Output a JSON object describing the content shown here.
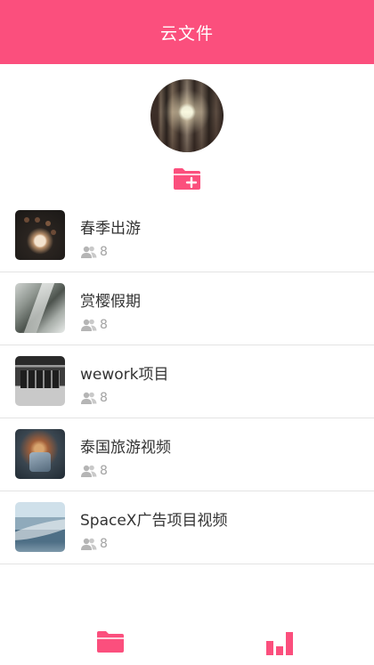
{
  "header": {
    "title": "云文件"
  },
  "colors": {
    "accent": "#fb4f7d",
    "muted": "#a3a3a3"
  },
  "profile": {
    "avatar_icon": "avatar-photo",
    "add_folder_icon": "folder-plus-icon"
  },
  "folders": [
    {
      "name": "春季出游",
      "members": "8"
    },
    {
      "name": "赏樱假期",
      "members": "8"
    },
    {
      "name": "wework项目",
      "members": "8"
    },
    {
      "name": "泰国旅游视频",
      "members": "8"
    },
    {
      "name": "SpaceX广告项目视频",
      "members": "8"
    }
  ],
  "tabbar": {
    "items": [
      "folder-icon",
      "bar-chart-icon"
    ]
  }
}
